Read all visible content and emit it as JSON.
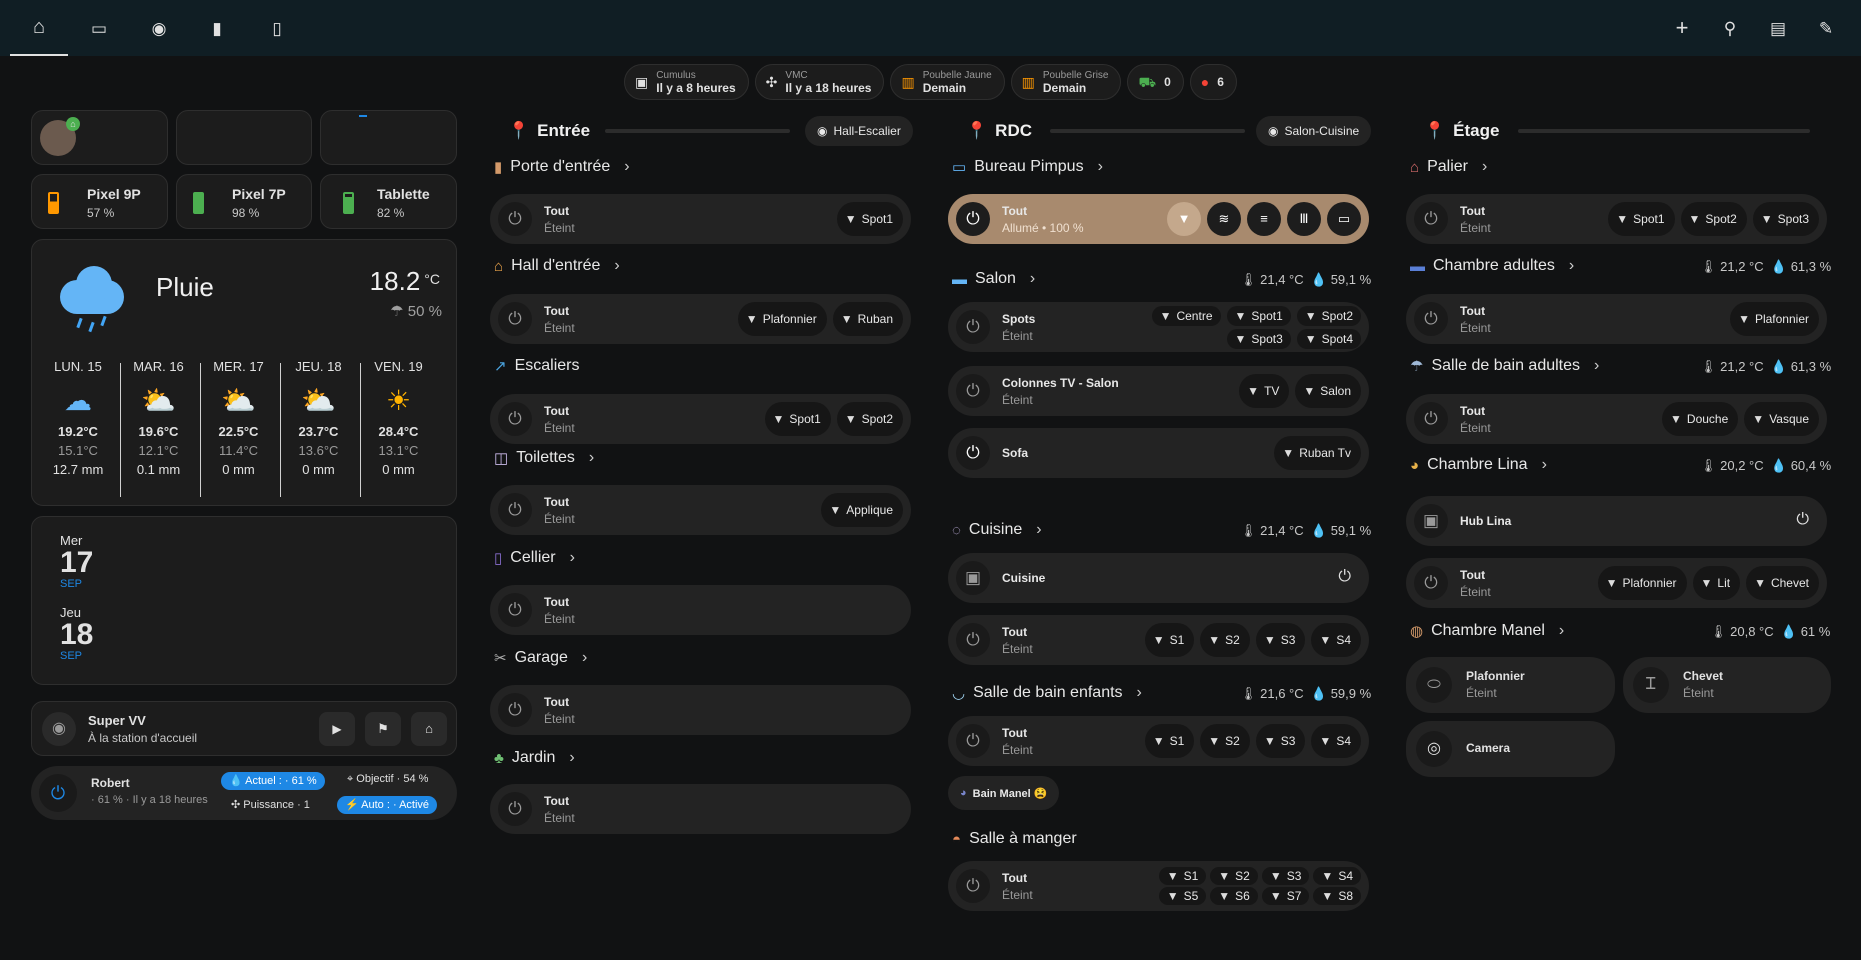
{
  "nav": {
    "items": [
      "home-icon",
      "monitor-icon",
      "robot-icon",
      "battery-icon",
      "tablet-download-icon"
    ],
    "actions": [
      "plus-icon",
      "search-icon",
      "chat-icon",
      "pencil-icon"
    ]
  },
  "chips": [
    {
      "icon": "cumulus-icon",
      "label": "Cumulus",
      "value": "Il y a 8 heures"
    },
    {
      "icon": "fan-icon",
      "label": "VMC",
      "value": "Il y a 18 heures"
    },
    {
      "icon": "trash-icon",
      "label": "Poubelle Jaune",
      "value": "Demain"
    },
    {
      "icon": "trash-icon",
      "label": "Poubelle Grise",
      "value": "Demain"
    },
    {
      "icon": "cart-icon",
      "label": "",
      "value": "0"
    },
    {
      "icon": "alert-bulb-icon",
      "label": "",
      "value": "6"
    }
  ],
  "colors": {
    "accent": "#1e88e5",
    "warning": "#ff9800",
    "battery_green": "#4caf50",
    "battery_orange": "#ff9800",
    "brown_tile": "#a88a6e",
    "error": "#f44336"
  },
  "devices": [
    {
      "name": "Pixel 9P",
      "pct": "57 %",
      "level": 0.57
    },
    {
      "name": "Pixel 7P",
      "pct": "98 %",
      "level": 0.98
    },
    {
      "name": "Tablette",
      "pct": "82 %",
      "level": 0.82
    }
  ],
  "weather": {
    "condition": "Pluie",
    "temp": "18.2",
    "unit": "°C",
    "humidity": "50 %",
    "days": [
      {
        "day": "LUN. 15",
        "high": "19.2°C",
        "low": "15.1°C",
        "rain": "12.7 mm",
        "icon": "rain-icon"
      },
      {
        "day": "MAR. 16",
        "high": "19.6°C",
        "low": "12.1°C",
        "rain": "0.1 mm",
        "icon": "partly-sunny-icon"
      },
      {
        "day": "MER. 17",
        "high": "22.5°C",
        "low": "11.4°C",
        "rain": "0 mm",
        "icon": "partly-sunny-icon"
      },
      {
        "day": "JEU. 18",
        "high": "23.7°C",
        "low": "13.6°C",
        "rain": "0 mm",
        "icon": "partly-sunny-icon"
      },
      {
        "day": "VEN. 19",
        "high": "28.4°C",
        "low": "13.1°C",
        "rain": "0 mm",
        "icon": "sunny-icon"
      }
    ]
  },
  "calendar": [
    {
      "dow": "Mer",
      "day": "17",
      "month": "SEP"
    },
    {
      "dow": "Jeu",
      "day": "18",
      "month": "SEP"
    }
  ],
  "vacuum": {
    "name": "Super VV",
    "status": "À la station d'accueil"
  },
  "humidifier": {
    "name": "Robert",
    "sub": "· 61 % · Il y a 18 heures",
    "current": "Actuel : · 61 %",
    "target": "Objectif · 54 %",
    "power": "Puissance · 1",
    "auto": "Auto : · Activé"
  },
  "entree": {
    "title": "Entrée",
    "area_button": "Hall-Escalier",
    "rooms": [
      {
        "name": "Porte d'entrée",
        "icon": "door-icon",
        "lights": [
          {
            "name": "Tout",
            "state": "Éteint",
            "actions": [
              "Spot1"
            ]
          }
        ]
      },
      {
        "name": "Hall d'entrée",
        "icon": "home-icon",
        "lights": [
          {
            "name": "Tout",
            "state": "Éteint",
            "actions": [
              "Plafonnier",
              "Ruban"
            ]
          }
        ]
      },
      {
        "name": "Escaliers",
        "icon": "stairs-icon",
        "lights": [
          {
            "name": "Tout",
            "state": "Éteint",
            "actions": [
              "Spot1",
              "Spot2"
            ]
          }
        ]
      },
      {
        "name": "Toilettes",
        "icon": "toilet-icon",
        "lights": [
          {
            "name": "Tout",
            "state": "Éteint",
            "actions": [
              "Applique"
            ]
          }
        ]
      },
      {
        "name": "Cellier",
        "icon": "cellar-icon",
        "lights": [
          {
            "name": "Tout",
            "state": "Éteint",
            "actions": []
          }
        ]
      },
      {
        "name": "Garage",
        "icon": "tools-icon",
        "lights": [
          {
            "name": "Tout",
            "state": "Éteint",
            "actions": []
          }
        ]
      },
      {
        "name": "Jardin",
        "icon": "tree-icon",
        "lights": [
          {
            "name": "Tout",
            "state": "Éteint",
            "actions": []
          }
        ]
      }
    ]
  },
  "rdc": {
    "title": "RDC",
    "area_button": "Salon-Cuisine",
    "rooms": [
      {
        "name": "Bureau Pimpus",
        "icon": "desktop-icon",
        "climate": "",
        "lights": [
          {
            "name": "Tout",
            "state": "Allumé • 100 %",
            "on": true,
            "actions": []
          }
        ]
      },
      {
        "name": "Salon",
        "icon": "sofa-icon",
        "climate": "21,4 °C  ·  59,1 %",
        "temp": "21,4 °C",
        "hum": "59,1 %"
      },
      {
        "name": "Cuisine",
        "icon": "food-icon",
        "temp": "21,4 °C",
        "hum": "59,1 %"
      },
      {
        "name": "Salle de bain enfants",
        "icon": "bath-icon",
        "temp": "21,6 °C",
        "hum": "59,9 %"
      },
      {
        "name": "Salle à manger",
        "icon": "dish-icon"
      }
    ],
    "salon_spots": {
      "name": "Spots",
      "state": "Éteint",
      "actions": [
        "Centre",
        "Spot1",
        "Spot2",
        "Spot3",
        "Spot4"
      ]
    },
    "salon_colonnes": {
      "name": "Colonnes TV - Salon",
      "state": "Éteint",
      "actions": [
        "TV",
        "Salon"
      ]
    },
    "salon_sofa": {
      "name": "Sofa",
      "actions": [
        "Ruban Tv"
      ]
    },
    "cuisine_speaker": {
      "name": "Cuisine"
    },
    "cuisine_tout": {
      "name": "Tout",
      "state": "Éteint",
      "actions": [
        "S1",
        "S2",
        "S3",
        "S4"
      ]
    },
    "sdb_tout": {
      "name": "Tout",
      "state": "Éteint",
      "actions": [
        "S1",
        "S2",
        "S3",
        "S4"
      ]
    },
    "bain_manel": "Bain Manel 😫",
    "sam_tout": {
      "name": "Tout",
      "state": "Éteint",
      "actions": [
        "S1",
        "S2",
        "S3",
        "S4",
        "S5",
        "S6",
        "S7",
        "S8"
      ]
    }
  },
  "etage": {
    "title": "Étage",
    "rooms": [
      {
        "name": "Palier",
        "icon": "chair-icon"
      },
      {
        "name": "Chambre adultes",
        "icon": "bed-icon",
        "temp": "21,2 °C",
        "hum": "61,3 %"
      },
      {
        "name": "Salle de bain adultes",
        "icon": "shower-icon",
        "temp": "21,2 °C",
        "hum": "61,3 %"
      },
      {
        "name": "Chambre Lina",
        "icon": "cat-icon",
        "temp": "20,2 °C",
        "hum": "60,4 %"
      },
      {
        "name": "Chambre Manel",
        "icon": "bear-icon",
        "temp": "20,8 °C",
        "hum": "61 %"
      }
    ],
    "palier_tout": {
      "name": "Tout",
      "state": "Éteint",
      "actions": [
        "Spot1",
        "Spot2",
        "Spot3"
      ]
    },
    "adultes_tout": {
      "name": "Tout",
      "state": "Éteint",
      "actions": [
        "Plafonnier"
      ]
    },
    "sdb_tout": {
      "name": "Tout",
      "state": "Éteint",
      "actions": [
        "Douche",
        "Vasque"
      ]
    },
    "hub_lina": {
      "name": "Hub Lina"
    },
    "lina_tout": {
      "name": "Tout",
      "state": "Éteint",
      "actions": [
        "Plafonnier",
        "Lit",
        "Chevet"
      ]
    },
    "manel_plafonnier": {
      "name": "Plafonnier",
      "state": "Éteint"
    },
    "manel_chevet": {
      "name": "Chevet",
      "state": "Éteint"
    },
    "manel_camera": {
      "name": "Camera"
    }
  }
}
